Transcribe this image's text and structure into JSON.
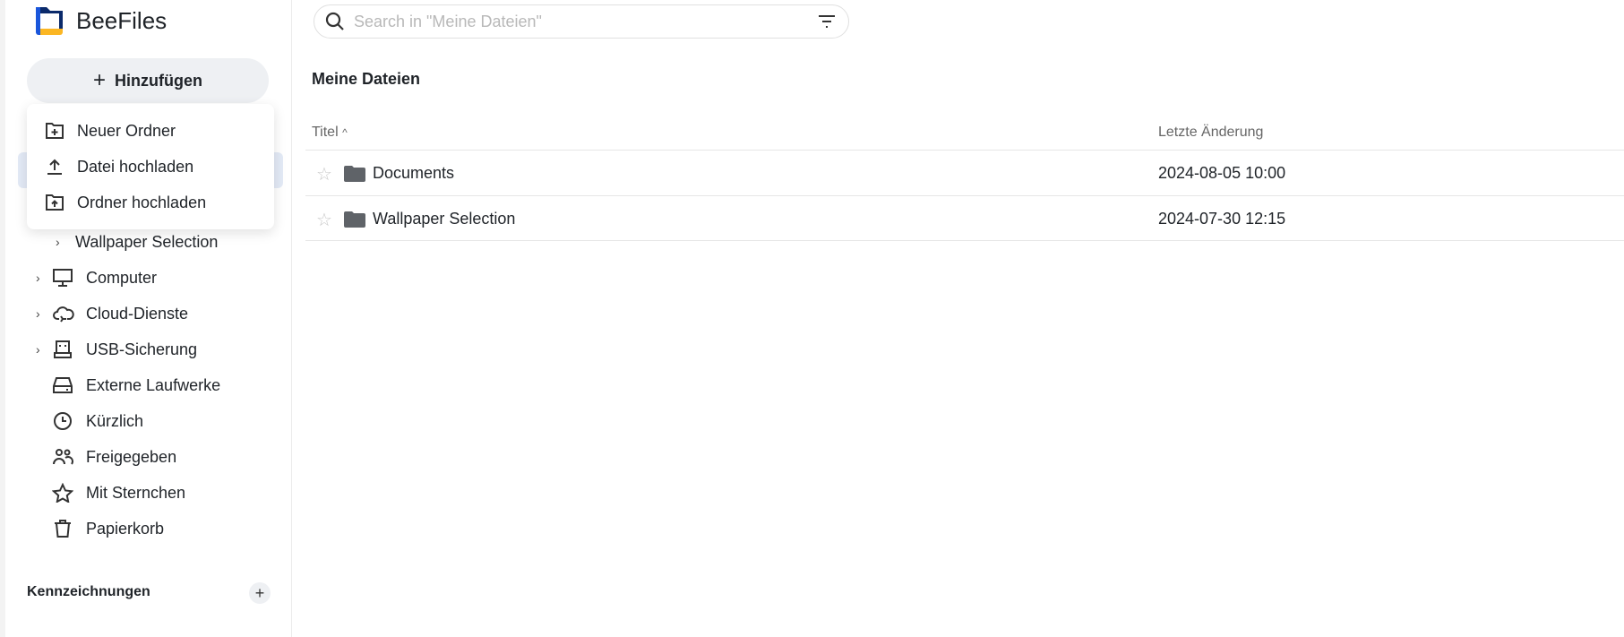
{
  "app": {
    "name": "BeeFiles",
    "brand_colors": {
      "blue": "#1a56db",
      "navy": "#0b2a6b",
      "yellow": "#fbb623"
    }
  },
  "sidebar": {
    "add_button": "Hinzufügen",
    "add_menu": [
      {
        "label": "Neuer Ordner",
        "icon": "folder-plus-icon"
      },
      {
        "label": "Datei hochladen",
        "icon": "upload-icon"
      },
      {
        "label": "Ordner hochladen",
        "icon": "folder-upload-icon"
      }
    ],
    "tree_child": "Wallpaper Selection",
    "items": [
      {
        "label": "Computer",
        "icon": "monitor-icon"
      },
      {
        "label": "Cloud-Dienste",
        "icon": "cloud-sync-icon"
      },
      {
        "label": "USB-Sicherung",
        "icon": "usb-icon"
      },
      {
        "label": "Externe Laufwerke",
        "icon": "drive-icon"
      },
      {
        "label": "Kürzlich",
        "icon": "clock-icon"
      },
      {
        "label": "Freigegeben",
        "icon": "users-icon"
      },
      {
        "label": "Mit Sternchen",
        "icon": "star-icon"
      },
      {
        "label": "Papierkorb",
        "icon": "trash-icon"
      }
    ],
    "labels_heading": "Kennzeichnungen",
    "labels_add": "+"
  },
  "search": {
    "placeholder": "Search in \"Meine Dateien\""
  },
  "main": {
    "title": "Meine Dateien",
    "columns": {
      "title": "Titel",
      "sort_indicator": "^",
      "modified": "Letzte Änderung"
    },
    "rows": [
      {
        "name": "Documents",
        "modified": "2024-08-05 10:00"
      },
      {
        "name": "Wallpaper Selection",
        "modified": "2024-07-30 12:15"
      }
    ]
  }
}
